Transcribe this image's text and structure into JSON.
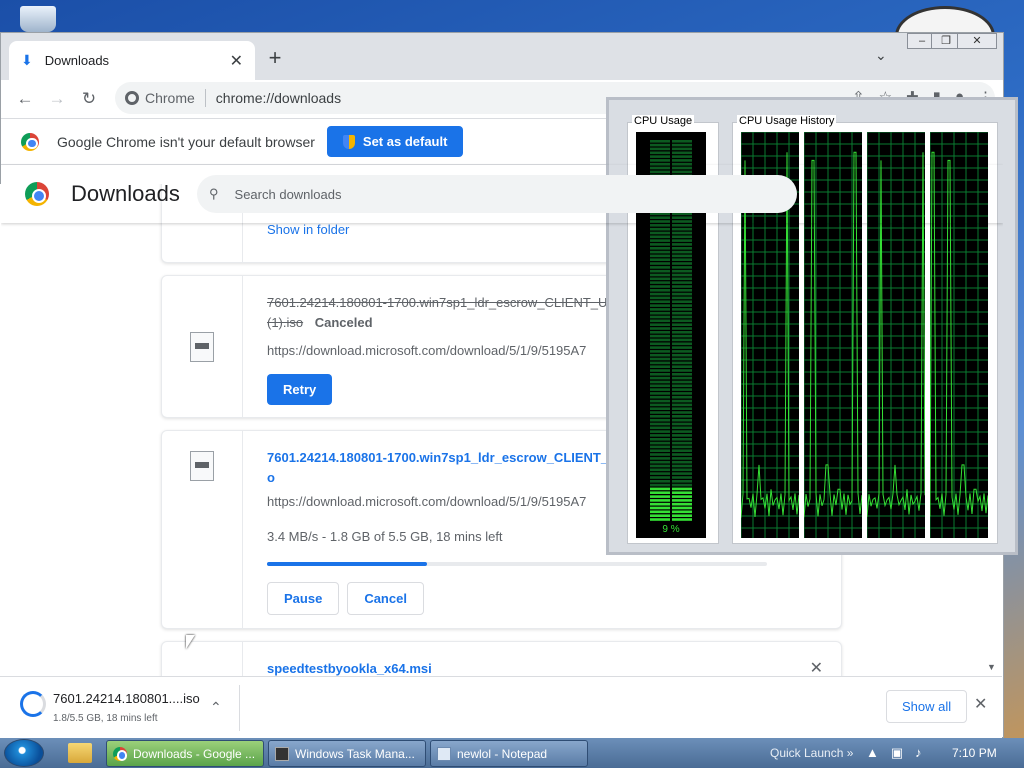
{
  "browser": {
    "tab_title": "Downloads",
    "omnibox_site": "Chrome",
    "omnibox_url": "chrome://downloads"
  },
  "infobar": {
    "message": "Google Chrome isn't your default browser",
    "button": "Set as default"
  },
  "downloads_page": {
    "title": "Downloads",
    "search_placeholder": "Search downloads",
    "items": [
      {
        "action_link": "Show in folder"
      },
      {
        "filename": "7601.24214.180801-1700.win7sp1_ldr_escrow_CLIENT_U",
        "filename_cont": "(1).iso",
        "status": "Canceled",
        "url": "https://download.microsoft.com/download/5/1/9/5195A7",
        "button": "Retry"
      },
      {
        "filename": "7601.24214.180801-1700.win7sp1_ldr_escrow_CLIENT_U",
        "filename_cont": "o",
        "url": "https://download.microsoft.com/download/5/1/9/5195A7",
        "progress_text": "3.4 MB/s - 1.8 GB of 5.5 GB, 18 mins left",
        "progress_fraction": 0.32,
        "pause": "Pause",
        "cancel": "Cancel"
      },
      {
        "filename": "speedtestbyookla_x64.msi"
      }
    ]
  },
  "download_shelf": {
    "filename": "7601.24214.180801....iso",
    "status": "1.8/5.5 GB, 18 mins left",
    "show_all": "Show all"
  },
  "task_manager": {
    "cpu_usage_label": "CPU Usage",
    "cpu_history_label": "CPU Usage History",
    "cpu_percent": "9 %",
    "cpu_fraction": 0.09,
    "colors": {
      "grid": "#0a7a30",
      "line": "#35e035",
      "meter_off": "#0c5a20",
      "meter_on": "#35e035"
    }
  },
  "taskbar": {
    "tasks": [
      "Downloads - Google ...",
      "Windows Task Mana...",
      "newlol - Notepad"
    ],
    "quick_launch": "Quick Launch",
    "quick_chevron": "»",
    "clock": "7:10 PM"
  },
  "icons": [
    "download-icon",
    "close-icon",
    "plus-icon",
    "chevron-down-icon",
    "back-icon",
    "forward-icon",
    "reload-icon",
    "share-icon",
    "star-icon",
    "extensions-icon",
    "sidepanel-icon",
    "profile-icon",
    "menu-icon",
    "search-icon",
    "shield-icon",
    "file-icon",
    "chevron-up-icon"
  ]
}
